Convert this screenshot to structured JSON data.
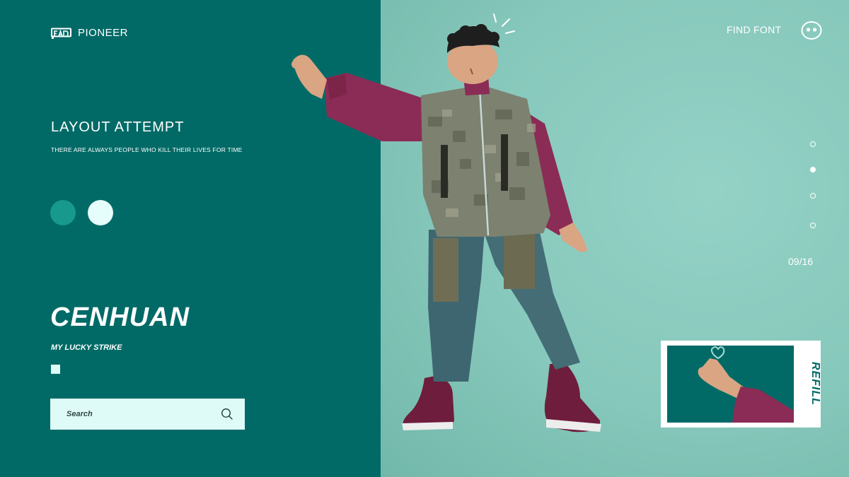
{
  "header": {
    "logo_text": "PIONEER",
    "find_font_label": "FIND FONT"
  },
  "intro": {
    "headline": "LAYOUT ATTEMPT",
    "subline": "THERE ARE ALWAYS PEOPLE WHO KILL THEIR LIVES FOR TIME"
  },
  "swatches": [
    "#17998D",
    "#E5FDFB"
  ],
  "brand": {
    "name": "CENHUAN",
    "tagline": "MY LUCKY STRIKE"
  },
  "search": {
    "placeholder": "Search"
  },
  "pagination": {
    "total_dots": 4,
    "active_index": 1,
    "counter": "09/16"
  },
  "card": {
    "label": "REFILL"
  },
  "colors": {
    "panel_dark": "#016A66",
    "panel_light": "#86C8BB",
    "accent_light": "#DFFBF8"
  },
  "icons": [
    "logo-icon",
    "search-icon",
    "face-icon"
  ]
}
